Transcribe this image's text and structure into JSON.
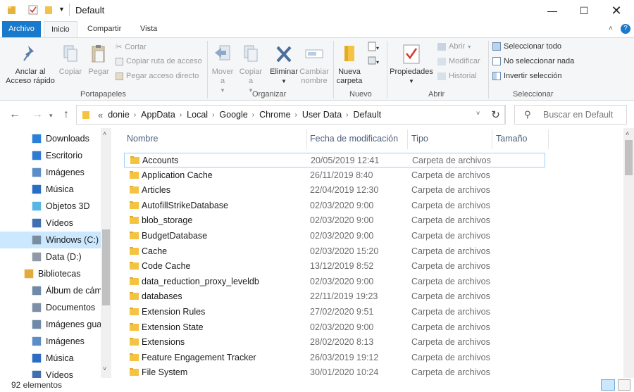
{
  "window": {
    "title": "Default"
  },
  "ribbon_tabs": [
    "Archivo",
    "Inicio",
    "Compartir",
    "Vista"
  ],
  "ribbon": {
    "portapapeles": {
      "group": "Portapapeles",
      "anclar": "Anclar al Acceso rápido",
      "copiar": "Copiar",
      "pegar": "Pegar",
      "cortar": "Cortar",
      "copiar_ruta": "Copiar ruta de acceso",
      "pegar_acceso": "Pegar acceso directo"
    },
    "organizar": {
      "group": "Organizar",
      "mover": "Mover a",
      "copiar": "Copiar a",
      "eliminar": "Eliminar",
      "cambiar": "Cambiar nombre"
    },
    "nuevo": {
      "group": "Nuevo",
      "nueva_carpeta": "Nueva carpeta"
    },
    "abrir": {
      "group": "Abrir",
      "propiedades": "Propiedades",
      "abrir": "Abrir",
      "modificar": "Modificar",
      "historial": "Historial"
    },
    "seleccionar": {
      "group": "Seleccionar",
      "todo": "Seleccionar todo",
      "nada": "No seleccionar nada",
      "invertir": "Invertir selección"
    }
  },
  "address": {
    "overflow": "«",
    "crumbs": [
      "donie",
      "AppData",
      "Local",
      "Google",
      "Chrome",
      "User Data",
      "Default"
    ],
    "search_placeholder": "Buscar en Default"
  },
  "nav": [
    {
      "label": "Downloads",
      "icon": "download-icon"
    },
    {
      "label": "Escritorio",
      "icon": "desktop-icon"
    },
    {
      "label": "Imágenes",
      "icon": "pictures-icon"
    },
    {
      "label": "Música",
      "icon": "music-icon"
    },
    {
      "label": "Objetos 3D",
      "icon": "3d-objects-icon"
    },
    {
      "label": "Vídeos",
      "icon": "videos-icon"
    },
    {
      "label": "Windows (C:)",
      "icon": "drive-c-icon",
      "selected": true
    },
    {
      "label": "Data (D:)",
      "icon": "drive-d-icon"
    },
    {
      "label": "Bibliotecas",
      "icon": "libraries-icon"
    },
    {
      "label": "Álbum de cáma",
      "icon": "camera-roll-icon"
    },
    {
      "label": "Documentos",
      "icon": "documents-icon"
    },
    {
      "label": "Imágenes guar",
      "icon": "saved-pictures-icon"
    },
    {
      "label": "Imágenes",
      "icon": "pictures-icon"
    },
    {
      "label": "Música",
      "icon": "music-icon"
    },
    {
      "label": "Vídeos",
      "icon": "videos-icon"
    }
  ],
  "columns": [
    "Nombre",
    "Fecha de modificación",
    "Tipo",
    "Tamaño"
  ],
  "files": [
    {
      "name": "Accounts",
      "date": "20/05/2019 12:41",
      "type": "Carpeta de archivos"
    },
    {
      "name": "Application Cache",
      "date": "26/11/2019 8:40",
      "type": "Carpeta de archivos"
    },
    {
      "name": "Articles",
      "date": "22/04/2019 12:30",
      "type": "Carpeta de archivos"
    },
    {
      "name": "AutofillStrikeDatabase",
      "date": "02/03/2020 9:00",
      "type": "Carpeta de archivos"
    },
    {
      "name": "blob_storage",
      "date": "02/03/2020 9:00",
      "type": "Carpeta de archivos"
    },
    {
      "name": "BudgetDatabase",
      "date": "02/03/2020 9:00",
      "type": "Carpeta de archivos"
    },
    {
      "name": "Cache",
      "date": "02/03/2020 15:20",
      "type": "Carpeta de archivos"
    },
    {
      "name": "Code Cache",
      "date": "13/12/2019 8:52",
      "type": "Carpeta de archivos"
    },
    {
      "name": "data_reduction_proxy_leveldb",
      "date": "02/03/2020 9:00",
      "type": "Carpeta de archivos"
    },
    {
      "name": "databases",
      "date": "22/11/2019 19:23",
      "type": "Carpeta de archivos"
    },
    {
      "name": "Extension Rules",
      "date": "27/02/2020 9:51",
      "type": "Carpeta de archivos"
    },
    {
      "name": "Extension State",
      "date": "02/03/2020 9:00",
      "type": "Carpeta de archivos"
    },
    {
      "name": "Extensions",
      "date": "28/02/2020 8:13",
      "type": "Carpeta de archivos"
    },
    {
      "name": "Feature Engagement Tracker",
      "date": "26/03/2019 19:12",
      "type": "Carpeta de archivos"
    },
    {
      "name": "File System",
      "date": "30/01/2020 10:24",
      "type": "Carpeta de archivos"
    }
  ],
  "status": {
    "count": "92 elementos"
  },
  "colors": {
    "file_tab": "#1979ca",
    "selection": "#cce8ff",
    "folder": "#ffcc4d"
  }
}
